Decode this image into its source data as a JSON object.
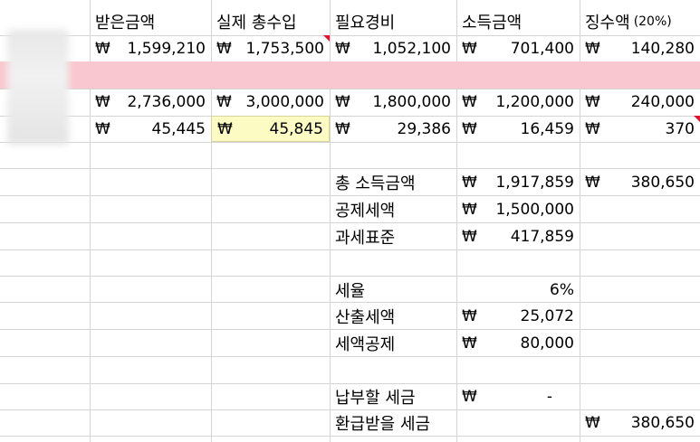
{
  "headers": {
    "received": "받은금액",
    "actual_income": "실제 총수입",
    "expenses": "필요경비",
    "income": "소득금액",
    "withholding": "징수액",
    "withholding_rate": "(20%)"
  },
  "currency": "₩",
  "rows": [
    {
      "received": "1,599,210",
      "actual_income": "1,753,500",
      "expenses": "1,052,100",
      "income": "701,400",
      "withholding": "140,280"
    },
    {
      "received": "2,736,000",
      "actual_income": "3,000,000",
      "expenses": "1,800,000",
      "income": "1,200,000",
      "withholding": "240,000"
    },
    {
      "received": "45,445",
      "actual_income": "45,845",
      "expenses": "29,386",
      "income": "16,459",
      "withholding": "370"
    }
  ],
  "summary": {
    "total_income_label": "총 소득금액",
    "total_income": "1,917,859",
    "total_withholding": "380,650",
    "deduction_label": "공제세액",
    "deduction": "1,500,000",
    "tax_base_label": "과세표준",
    "tax_base": "417,859",
    "tax_rate_label": "세율",
    "tax_rate": "6%",
    "calculated_tax_label": "산출세액",
    "calculated_tax": "25,072",
    "tax_credit_label": "세액공제",
    "tax_credit": "80,000",
    "payable_label": "납부할 세금",
    "payable": "-",
    "refund_label": "환급받을 세금",
    "refund": "380,650"
  },
  "colors": {
    "selected_row_band": "#f9c7cf",
    "highlight_cell": "#fdfbc4",
    "comment_marker": "#e8102a"
  }
}
